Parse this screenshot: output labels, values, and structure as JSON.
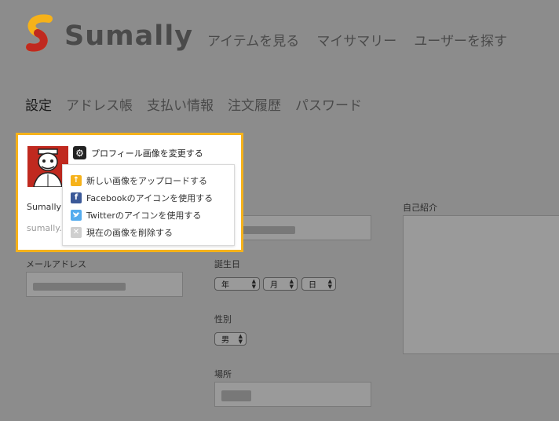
{
  "header": {
    "logo_text": "Sumally",
    "brand_color_orange": "#f6b21a",
    "brand_color_red": "#c0291f",
    "nav": [
      {
        "label": "アイテムを見る"
      },
      {
        "label": "マイサマリー"
      },
      {
        "label": "ユーザーを探す"
      }
    ]
  },
  "tabs": [
    {
      "label": "設定",
      "active": true
    },
    {
      "label": "アドレス帳"
    },
    {
      "label": "支払い情報"
    },
    {
      "label": "注文履歴"
    },
    {
      "label": "パスワード"
    }
  ],
  "profile": {
    "change_photo_label": "プロフィール画像を変更する",
    "gear_icon": "gear-icon",
    "name": "Sumally",
    "url": "sumally."
  },
  "photo_menu": {
    "items": [
      {
        "label": "新しい画像をアップロードする",
        "icon": "upload-icon",
        "color": "#f6b21a"
      },
      {
        "label": "Facebookのアイコンを使用する",
        "icon": "facebook-icon",
        "color": "#3b5998"
      },
      {
        "label": "Twitterのアイコンを使用する",
        "icon": "twitter-icon",
        "color": "#55acee"
      },
      {
        "label": "現在の画像を削除する",
        "icon": "delete-icon",
        "color": "#cfcfcf"
      }
    ]
  },
  "form": {
    "email_label": "メールアドレス",
    "birthday_label": "誕生日",
    "birthday_year": "年",
    "birthday_month": "月",
    "birthday_day": "日",
    "gender_label": "性別",
    "gender_value": "男",
    "location_label": "場所",
    "bio_label": "自己紹介"
  }
}
